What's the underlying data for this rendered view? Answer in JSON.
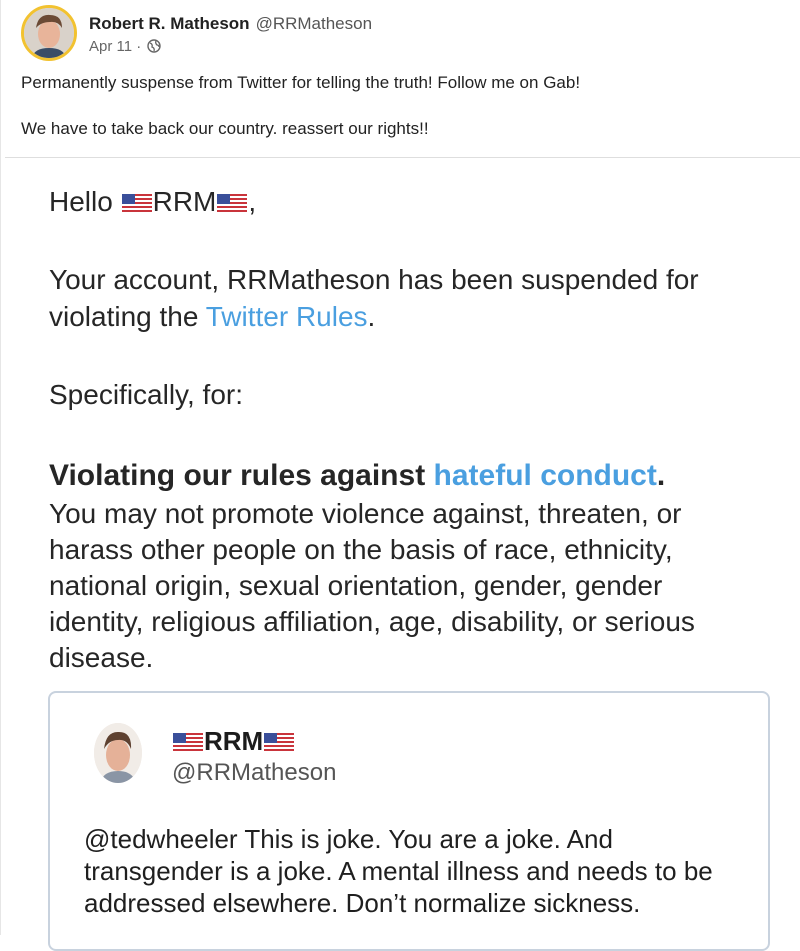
{
  "post": {
    "author_name": "Robert R. Matheson",
    "author_handle": "@RRMatheson",
    "date": "Apr 11",
    "separator": "·",
    "audience_icon": "globe-icon",
    "text_line1": "Permanently suspense from Twitter for telling the truth! Follow me on Gab!",
    "text_line2": "We have to take back our country. reassert our rights!!"
  },
  "email": {
    "greeting_prefix": "Hello ",
    "greeting_name": "RRM",
    "greeting_suffix": ",",
    "body_line1": "Your account, RRMatheson has been suspended for",
    "body_line2_prefix": "violating the ",
    "body_line2_link": "Twitter Rules",
    "body_line2_suffix": ".",
    "specifically": "Specifically, for:",
    "violation_bold": "Violating our rules against ",
    "violation_link": "hateful conduct",
    "violation_period": ".",
    "desc_lines": [
      "You may not promote violence against, threaten, or",
      "harass other people on the basis of race, ethnicity,",
      "national origin, sexual orientation, gender, gender",
      "identity, religious affiliation, age, disability, or serious",
      "disease."
    ]
  },
  "tweet": {
    "display_name": "RRM",
    "handle": "@RRMatheson",
    "text_lines": [
      "@tedwheeler This is joke. You are a joke. And",
      "transgender is a joke. A mental illness and needs to be",
      "addressed elsewhere. Don’t normalize sickness."
    ]
  },
  "colors": {
    "link": "#4a9fe0",
    "avatar_ring": "#f2c230",
    "card_border": "#c8d2de"
  }
}
